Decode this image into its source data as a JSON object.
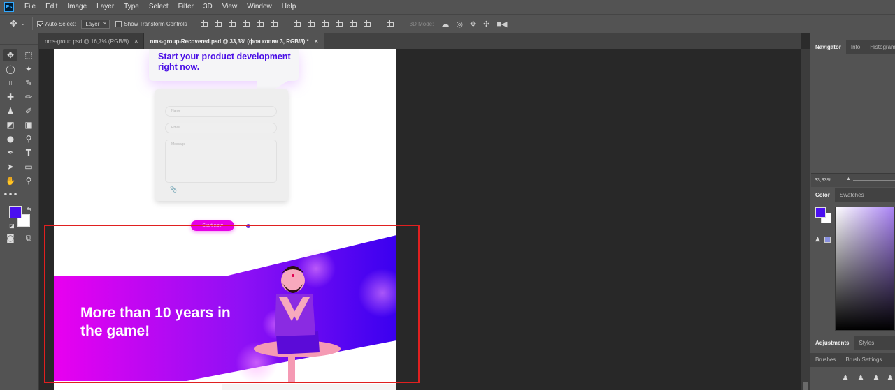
{
  "app": {
    "logo": "Ps"
  },
  "menu": [
    "File",
    "Edit",
    "Image",
    "Layer",
    "Type",
    "Select",
    "Filter",
    "3D",
    "View",
    "Window",
    "Help"
  ],
  "options_bar": {
    "auto_select_label": "Auto-Select:",
    "auto_select_checked": true,
    "target_value": "Layer",
    "show_transform_label": "Show Transform Controls",
    "three_d_mode_label": "3D Mode:"
  },
  "document_tabs": [
    {
      "label": "nms-group.psd @ 16,7% (RGB/8)",
      "close": "×",
      "active": false
    },
    {
      "label": "nms-group-Recovered.psd @ 33,3% (фон копия 3, RGB/8) *",
      "close": "×",
      "active": true
    }
  ],
  "canvas": {
    "bubble_title": "Start your product development right now.",
    "form": {
      "name_placeholder": "Name",
      "email_placeholder": "Email",
      "message_placeholder": "Message"
    },
    "button_label": "Start now",
    "banner_title": "More than 10 years in the game!"
  },
  "panels": {
    "navigator_tabs": [
      "Navigator",
      "Info",
      "Histogram"
    ],
    "zoom": "33,33%",
    "color_tabs": [
      "Color",
      "Swatches"
    ],
    "adjust_tabs": [
      "Adjustments",
      "Styles"
    ],
    "brush_tabs": [
      "Brushes",
      "Brush Settings"
    ]
  },
  "colors": {
    "foreground": "#4a0ff0",
    "background": "#ffffff",
    "highlight_box": "#e02020",
    "brand_purple": "#4b10e6",
    "brand_magenta": "#e600e6"
  },
  "icons": {
    "tools": [
      "move-icon",
      "marquee-icon",
      "lasso-icon",
      "magic-wand-icon",
      "crop-icon",
      "eyedropper-icon",
      "healing-icon",
      "brush-icon",
      "stamp-icon",
      "history-brush-icon",
      "eraser-icon",
      "gradient-icon",
      "blur-icon",
      "dodge-icon",
      "pen-icon",
      "type-icon",
      "path-select-icon",
      "rectangle-icon",
      "hand-icon",
      "zoom-icon",
      "more-tools-icon"
    ]
  }
}
